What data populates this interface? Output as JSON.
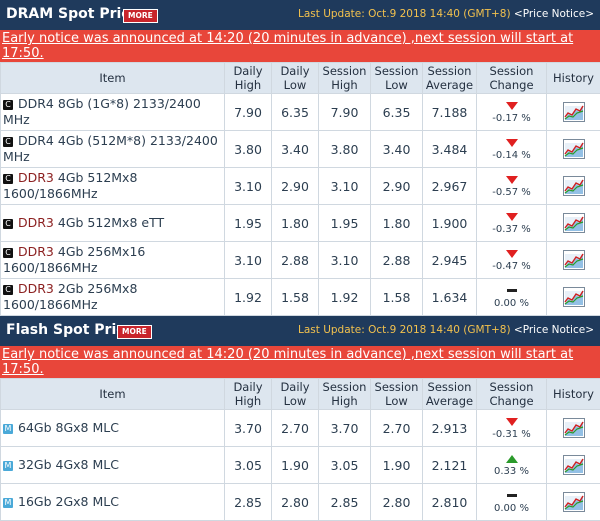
{
  "dram": {
    "title": "DRAM Spot Price",
    "more_label": "MORE",
    "last_update": "Last Update: Oct.9 2018 14:40 (GMT+8)",
    "price_notice": "<Price Notice>",
    "notice": "Early notice was announced at 14:20 (20 minutes in advance) ,next session will start at 17:50.",
    "headers": [
      "Item",
      "Daily High",
      "Daily Low",
      "Session High",
      "Session Low",
      "Session Average",
      "Session Change",
      "History"
    ],
    "rows": [
      {
        "badge": "C",
        "prefix": "",
        "item": "DDR4 8Gb (1G*8) 2133/2400 MHz",
        "daily_high": "7.90",
        "daily_low": "6.35",
        "session_high": "7.90",
        "session_low": "6.35",
        "session_avg": "7.188",
        "change": "-0.17 %",
        "trend": "down"
      },
      {
        "badge": "C",
        "prefix": "",
        "item": "DDR4 4Gb (512M*8) 2133/2400 MHz",
        "daily_high": "3.80",
        "daily_low": "3.40",
        "session_high": "3.80",
        "session_low": "3.40",
        "session_avg": "3.484",
        "change": "-0.14 %",
        "trend": "down"
      },
      {
        "badge": "C",
        "prefix": "DDR3",
        "item": " 4Gb 512Mx8 1600/1866MHz",
        "daily_high": "3.10",
        "daily_low": "2.90",
        "session_high": "3.10",
        "session_low": "2.90",
        "session_avg": "2.967",
        "change": "-0.57 %",
        "trend": "down"
      },
      {
        "badge": "C",
        "prefix": "DDR3",
        "item": " 4Gb 512Mx8 eTT",
        "daily_high": "1.95",
        "daily_low": "1.80",
        "session_high": "1.95",
        "session_low": "1.80",
        "session_avg": "1.900",
        "change": "-0.37 %",
        "trend": "down"
      },
      {
        "badge": "C",
        "prefix": "DDR3",
        "item": " 4Gb 256Mx16 1600/1866MHz",
        "daily_high": "3.10",
        "daily_low": "2.88",
        "session_high": "3.10",
        "session_low": "2.88",
        "session_avg": "2.945",
        "change": "-0.47 %",
        "trend": "down"
      },
      {
        "badge": "C",
        "prefix": "DDR3",
        "item": " 2Gb 256Mx8 1600/1866MHz",
        "daily_high": "1.92",
        "daily_low": "1.58",
        "session_high": "1.92",
        "session_low": "1.58",
        "session_avg": "1.634",
        "change": "0.00 %",
        "trend": "flat"
      }
    ]
  },
  "flash": {
    "title": "Flash Spot Price",
    "more_label": "MORE",
    "last_update": "Last Update: Oct.9 2018 14:40 (GMT+8)",
    "price_notice": "<Price Notice>",
    "notice": "Early notice was announced at 14:20 (20 minutes in advance) ,next session will start at 17:50.",
    "headers": [
      "Item",
      "Daily High",
      "Daily Low",
      "Session High",
      "Session Low",
      "Session Average",
      "Session Change",
      "History"
    ],
    "rows": [
      {
        "badge": "M",
        "prefix": "",
        "item": "64Gb 8Gx8 MLC",
        "daily_high": "3.70",
        "daily_low": "2.70",
        "session_high": "3.70",
        "session_low": "2.70",
        "session_avg": "2.913",
        "change": "-0.31 %",
        "trend": "down"
      },
      {
        "badge": "M",
        "prefix": "",
        "item": "32Gb 4Gx8 MLC",
        "daily_high": "3.05",
        "daily_low": "1.90",
        "session_high": "3.05",
        "session_low": "1.90",
        "session_avg": "2.121",
        "change": "0.33 %",
        "trend": "up"
      },
      {
        "badge": "M",
        "prefix": "",
        "item": "16Gb 2Gx8 MLC",
        "daily_high": "2.85",
        "daily_low": "2.80",
        "session_high": "2.85",
        "session_low": "2.80",
        "session_avg": "2.810",
        "change": "0.00 %",
        "trend": "flat"
      }
    ]
  },
  "colors": {
    "header_bg": "#1f3a5c",
    "notice_bg": "#e8463a",
    "down": "#e02020",
    "up": "#2a9a2a"
  }
}
